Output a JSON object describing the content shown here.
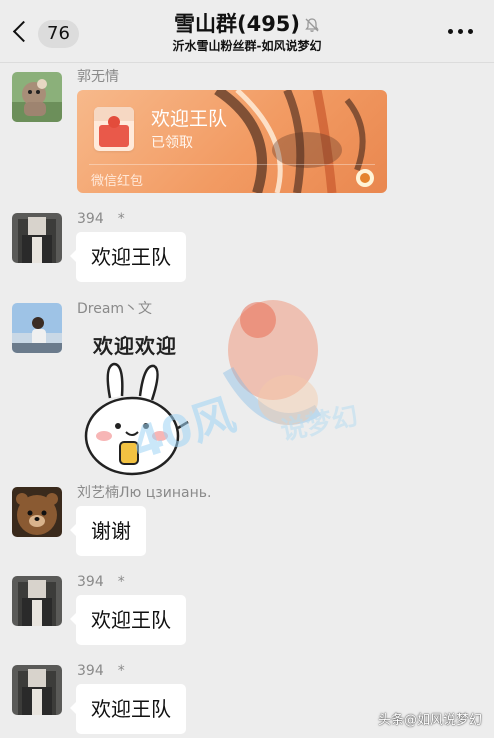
{
  "header": {
    "back_count": "76",
    "title": "雪山群(495)",
    "subtitle": "沂水雪山粉丝群-如风说梦幻"
  },
  "messages": [
    {
      "sender": "郭无情",
      "type": "red_packet",
      "red_packet": {
        "title": "欢迎王队",
        "status": "已领取",
        "footer": "微信红包"
      }
    },
    {
      "sender": "394　*",
      "type": "text",
      "text": "欢迎王队"
    },
    {
      "sender": "Dream丶文",
      "type": "sticker",
      "sticker": {
        "caption": "欢迎欢迎"
      },
      "watermark": {
        "text_number": "40风",
        "text_tag": "说梦幻"
      }
    },
    {
      "sender": "刘艺楠Лю цзинань.",
      "type": "text",
      "text": "谢谢"
    },
    {
      "sender": "394　*",
      "type": "text",
      "text": "欢迎王队"
    },
    {
      "sender": "394　*",
      "type": "text",
      "text": "欢迎王队"
    }
  ],
  "footer_tag": "头条@如风说梦幻",
  "colors": {
    "background": "#ededed",
    "bubble": "#ffffff",
    "red_packet": "#f29b63"
  },
  "icons": [
    "back-chevron-icon",
    "mute-bell-icon",
    "more-dots-icon"
  ]
}
